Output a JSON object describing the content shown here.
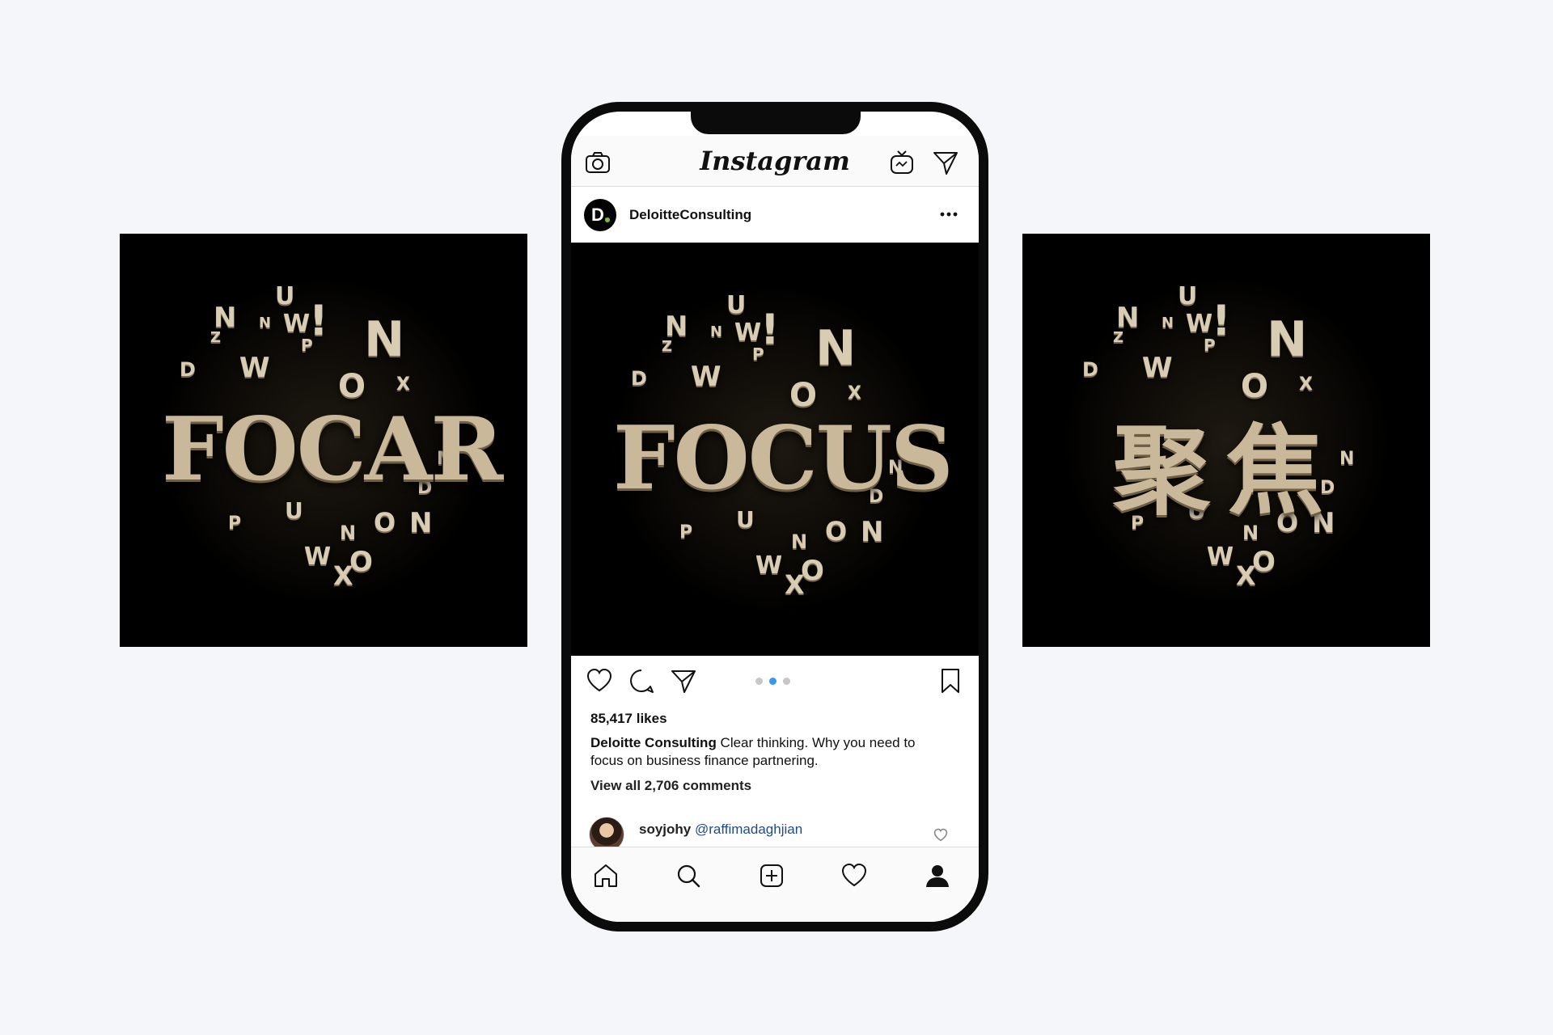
{
  "panels": {
    "left": {
      "word": "FOCAR"
    },
    "center": {
      "word": "FOCUS"
    },
    "right": {
      "word": "聚焦"
    },
    "scattered_letters": [
      "N",
      "U",
      "N",
      "W",
      "!",
      "P",
      "N",
      "Z",
      "D",
      "W",
      "O",
      "X",
      "U",
      "P",
      "O",
      "N",
      "N",
      "D",
      "W",
      "O",
      "X",
      "N"
    ]
  },
  "instagram": {
    "logo": "Instagram",
    "header_icons": [
      "camera-icon",
      "igtv-icon",
      "direct-message-icon"
    ],
    "post": {
      "account_initial": "D.",
      "account_name": "DeloitteConsulting",
      "more_icon": "more-options-icon",
      "carousel": {
        "count": 3,
        "active_index": 1
      },
      "likes": "85,417 likes",
      "caption_user": "Deloitte Consulting",
      "caption_text": " Clear thinking. Why you need to focus on business finance partnering.",
      "view_all_comments": "View all 2,706 comments",
      "comment": {
        "user": "soyjohy",
        "mention": "@raffimadaghjian"
      }
    },
    "tabbar": [
      "home-icon",
      "search-icon",
      "new-post-icon",
      "activity-heart-icon",
      "profile-icon"
    ]
  },
  "colors": {
    "background": "#f5f6fa",
    "accent_blue": "#3897f0",
    "deloitte_green": "#86bc25",
    "mention_blue": "#1f4a8a"
  }
}
